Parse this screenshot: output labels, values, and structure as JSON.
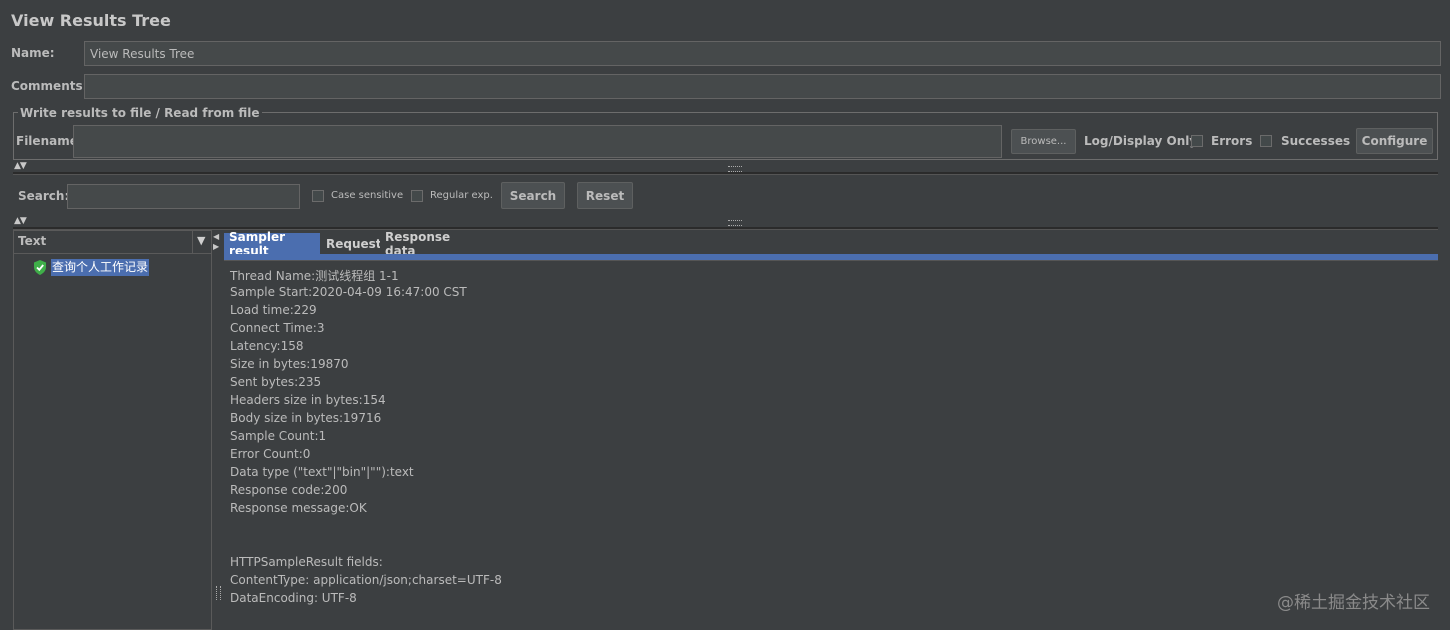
{
  "title": "View Results Tree",
  "name": {
    "label": "Name:",
    "value": "View Results Tree"
  },
  "comments": {
    "label": "Comments:",
    "value": ""
  },
  "file_group": {
    "legend": "Write results to file / Read from file",
    "filename_label": "Filename",
    "filename_value": "",
    "browse_label": "Browse...",
    "log_display_label": "Log/Display Only:",
    "errors_label": "Errors",
    "successes_label": "Successes",
    "configure_label": "Configure"
  },
  "search": {
    "label": "Search:",
    "value": "",
    "case_sensitive_label": "Case sensitive",
    "regex_label": "Regular exp.",
    "search_button": "Search",
    "reset_button": "Reset"
  },
  "tree": {
    "renderer": "Text",
    "items": [
      {
        "label": "查询个人工作记录",
        "status": "success"
      }
    ]
  },
  "tabs": [
    "Sampler result",
    "Request",
    "Response data"
  ],
  "sampler_result": [
    "Thread Name:测试线程组 1-1",
    "Sample Start:2020-04-09 16:47:00 CST",
    "Load time:229",
    "Connect Time:3",
    "Latency:158",
    "Size in bytes:19870",
    "Sent bytes:235",
    "Headers size in bytes:154",
    "Body size in bytes:19716",
    "Sample Count:1",
    "Error Count:0",
    "Data type (\"text\"|\"bin\"|\"\"):text",
    "Response code:200",
    "Response message:OK",
    "",
    "",
    "HTTPSampleResult fields:",
    "ContentType: application/json;charset=UTF-8",
    "DataEncoding: UTF-8"
  ],
  "watermark": "@稀土掘金技术社区",
  "colors": {
    "accent": "#4b6eaf",
    "background": "#3c3f41",
    "success_icon": "#3fae49"
  }
}
